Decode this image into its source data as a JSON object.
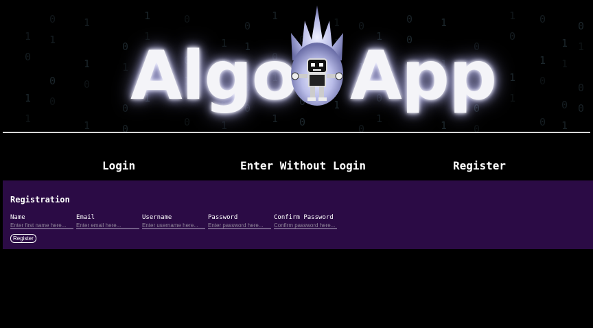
{
  "logo": {
    "word1": "Algo",
    "word2": "App",
    "mascot": "robot-mascot-icon"
  },
  "matrix_digits": [
    "1",
    "0",
    "1",
    "1",
    "0",
    "1",
    "0",
    "0",
    "1",
    "1",
    "0",
    "1",
    "0",
    "1",
    "0",
    "0",
    "1",
    "1",
    "0",
    "1",
    "0",
    "0",
    "1",
    "0",
    "1",
    "1",
    "0",
    "1",
    "0",
    "1",
    "0",
    "0"
  ],
  "nav": {
    "login": "Login",
    "enter_without_login": "Enter Without Login",
    "register": "Register"
  },
  "registration": {
    "title": "Registration",
    "fields": {
      "name": {
        "label": "Name",
        "placeholder": "Enter first name here..."
      },
      "email": {
        "label": "Email",
        "placeholder": "Enter email here..."
      },
      "username": {
        "label": "Username",
        "placeholder": "Enter username here..."
      },
      "password": {
        "label": "Password",
        "placeholder": "Enter password here..."
      },
      "confirm_password": {
        "label": "Confirm Password",
        "placeholder": "Confirm password here..."
      }
    },
    "submit_label": "Register"
  },
  "colors": {
    "background": "#000000",
    "panel": "#2b0b45",
    "divider": "#d8d8d8"
  }
}
